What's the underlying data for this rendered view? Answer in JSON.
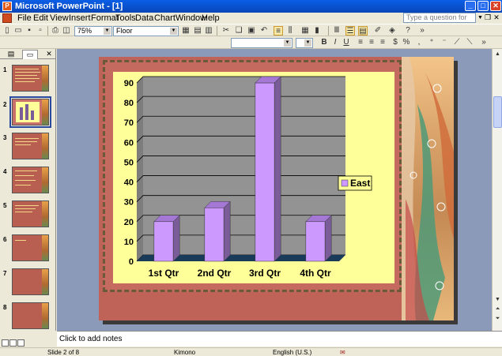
{
  "window": {
    "title": "Microsoft PowerPoint - [1]",
    "minimize": "_",
    "maximize": "□",
    "close": "✕"
  },
  "menu": {
    "items": [
      "File",
      "Edit",
      "View",
      "Insert",
      "Format",
      "Tools",
      "Data",
      "Chart",
      "Window",
      "Help"
    ],
    "help_placeholder": "Type a question for help"
  },
  "toolbar": {
    "zoom": "75%",
    "chart_object": "Floor"
  },
  "slide_pane": {
    "slides": [
      "1",
      "2",
      "3",
      "4",
      "5",
      "6",
      "7",
      "8"
    ],
    "selected": "2"
  },
  "notes": {
    "placeholder": "Click to add notes"
  },
  "status": {
    "slide": "Slide 2 of 8",
    "design": "Kimono",
    "language": "English (U.S.)"
  },
  "colors": {
    "bar_front": "#cc99ff",
    "bar_side": "#7a5c99",
    "bar_top": "#a678d6",
    "plot_wall": "#939393",
    "chart_area": "#ffff99",
    "floor": "#1a3a5a",
    "slide_bg": "#bf6258"
  },
  "chart_data": {
    "type": "bar",
    "categories": [
      "1st Qtr",
      "2nd Qtr",
      "3rd Qtr",
      "4th Qtr"
    ],
    "series": [
      {
        "name": "East",
        "values": [
          20,
          27,
          90,
          20
        ]
      }
    ],
    "ylim": [
      0,
      90
    ],
    "y_ticks": [
      "0",
      "10",
      "20",
      "30",
      "40",
      "50",
      "60",
      "70",
      "80",
      "90"
    ],
    "grid": true,
    "legend": "right"
  }
}
